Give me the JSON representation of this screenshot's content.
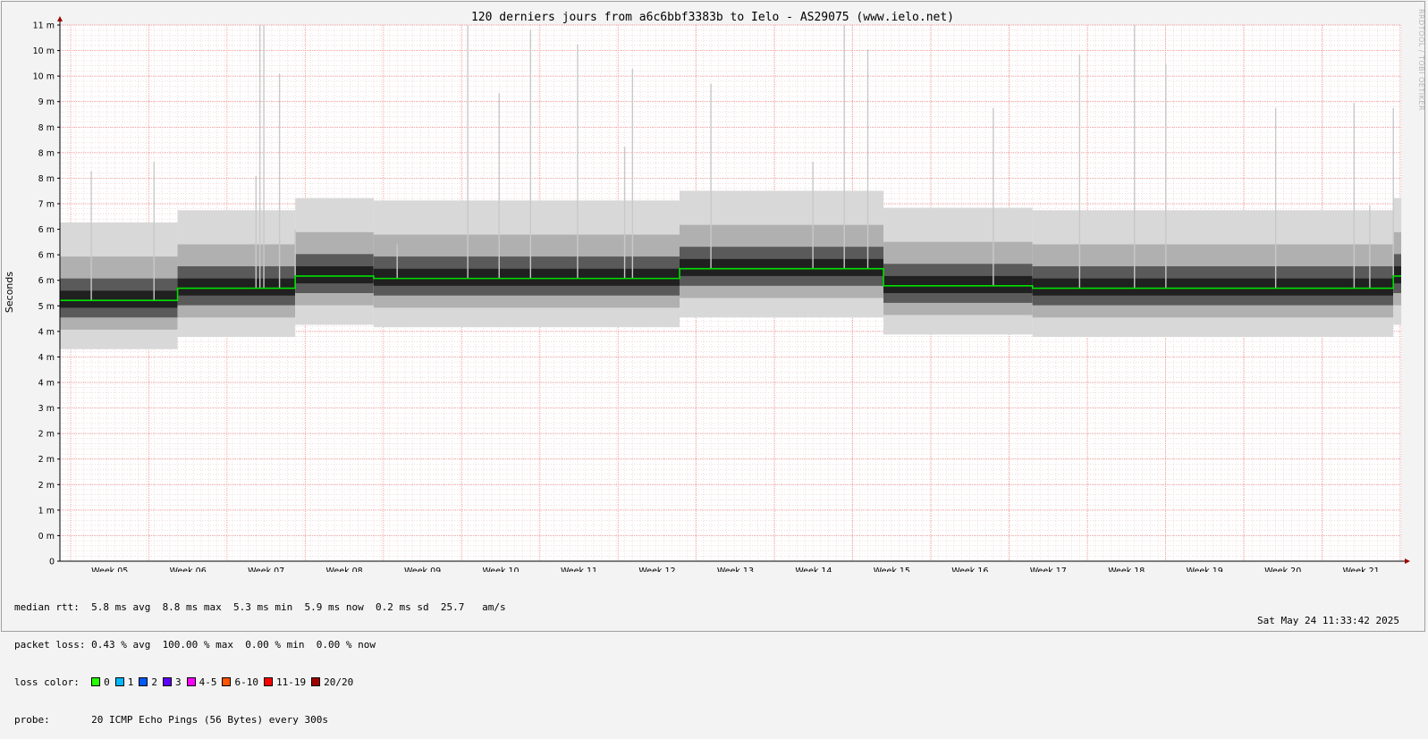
{
  "chart_data": {
    "type": "area",
    "title": "120 derniers jours from a6c6bbf3383b to Ielo - AS29075 (www.ielo.net)",
    "ylabel": "Seconds",
    "xlabel": "",
    "y_tick_labels": [
      "0",
      "0 m",
      "1 m",
      "2 m",
      "2 m",
      "2 m",
      "3 m",
      "4 m",
      "4 m",
      "4 m",
      "5 m",
      "6 m",
      "6 m",
      "6 m",
      "7 m",
      "8 m",
      "8 m",
      "8 m",
      "9 m",
      "10 m",
      "10 m",
      "11 m"
    ],
    "x_tick_labels": [
      "Week 05",
      "Week 06",
      "Week 07",
      "Week 08",
      "Week 09",
      "Week 10",
      "Week 11",
      "Week 12",
      "Week 13",
      "Week 14",
      "Week 15",
      "Week 16",
      "Week 17",
      "Week 18",
      "Week 19",
      "Week 20",
      "Week 21"
    ],
    "ylim": [
      0,
      11
    ],
    "grid": true,
    "median_segments": [
      {
        "from": 0,
        "to": 15,
        "value": 5.35
      },
      {
        "from": 15,
        "to": 30,
        "value": 5.6
      },
      {
        "from": 30,
        "to": 40,
        "value": 5.85
      },
      {
        "from": 40,
        "to": 79,
        "value": 5.8
      },
      {
        "from": 79,
        "to": 105,
        "value": 6.0
      },
      {
        "from": 105,
        "to": 124,
        "value": 5.65
      },
      {
        "from": 124,
        "to": 170,
        "value": 5.6
      },
      {
        "from": 170,
        "to": 171,
        "value": 5.85
      }
    ],
    "spikes": [
      {
        "x": 4,
        "value": 8.0
      },
      {
        "x": 12,
        "value": 8.2
      },
      {
        "x": 25,
        "value": 7.9
      },
      {
        "x": 25.5,
        "value": 11
      },
      {
        "x": 26,
        "value": 11
      },
      {
        "x": 28,
        "value": 10.0
      },
      {
        "x": 30,
        "value": 6.8
      },
      {
        "x": 43,
        "value": 6.5
      },
      {
        "x": 52,
        "value": 11
      },
      {
        "x": 56,
        "value": 9.6
      },
      {
        "x": 60,
        "value": 10.9
      },
      {
        "x": 66,
        "value": 10.6
      },
      {
        "x": 72,
        "value": 8.5
      },
      {
        "x": 73,
        "value": 10.1
      },
      {
        "x": 83,
        "value": 9.8
      },
      {
        "x": 96,
        "value": 8.2
      },
      {
        "x": 100,
        "value": 11
      },
      {
        "x": 103,
        "value": 10.5
      },
      {
        "x": 119,
        "value": 9.3
      },
      {
        "x": 130,
        "value": 10.4
      },
      {
        "x": 137,
        "value": 11
      },
      {
        "x": 141,
        "value": 10.2
      },
      {
        "x": 155,
        "value": 9.3
      },
      {
        "x": 165,
        "value": 9.4
      },
      {
        "x": 167,
        "value": 7.3
      },
      {
        "x": 170,
        "value": 9.3
      }
    ],
    "x_range": [
      0,
      171
    ],
    "colors": {
      "median": "#00e000",
      "band_dark": "#202020",
      "band_light": "#d8d8d8",
      "grid_minor": "#e6c8c8",
      "grid_major": "#f08080"
    }
  },
  "stats": {
    "median_rtt": "median rtt:  5.8 ms avg  8.8 ms max  5.3 ms min  5.9 ms now  0.2 ms sd  25.7   am/s",
    "packet_loss": "packet loss: 0.43 % avg  100.00 % max  0.00 % min  0.00 % now",
    "loss_color_label": "loss color:",
    "loss_colors": [
      {
        "label": "0",
        "color": "#26ff00"
      },
      {
        "label": "1",
        "color": "#00b8ff"
      },
      {
        "label": "2",
        "color": "#0059ff"
      },
      {
        "label": "3",
        "color": "#5e00ff"
      },
      {
        "label": "4-5",
        "color": "#ff00ff"
      },
      {
        "label": "6-10",
        "color": "#ff5500"
      },
      {
        "label": "11-19",
        "color": "#ff0000"
      },
      {
        "label": "20/20",
        "color": "#a10000"
      }
    ],
    "probe": "probe:       20 ICMP Echo Pings (56 Bytes) every 300s"
  },
  "timestamp": "Sat May 24 11:33:42 2025",
  "watermark": "RRDTOOL / TOBI OETIKER"
}
